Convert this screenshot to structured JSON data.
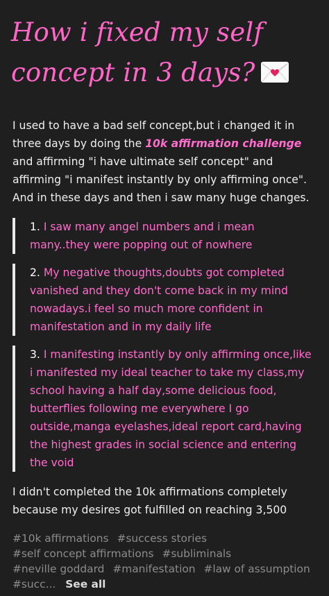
{
  "post": {
    "title_line1": "How i fixed my self",
    "title_line2": "concept in 3 days?",
    "title_emoji": "love-letter-icon",
    "intro_before": "I used to have a bad self concept,but i changed it in three days by doing the ",
    "intro_highlight": "10k affirmation challenge",
    "intro_after": " and affirming \"i have ultimate self concept\" and affirming \"i manifest instantly by only affirming once\". And in these days and then i saw many huge changes.",
    "quotes": [
      {
        "number": "1.",
        "text": "I saw many angel numbers and i mean many..they were popping out of nowhere"
      },
      {
        "number": "2.",
        "text": "My negative thoughts,doubts got completed vanished and they don't come back in my mind nowadays.i feel so much more confident in manifestation and in my daily life"
      },
      {
        "number": "3.",
        "text": "I manifesting instantly by only affirming once,like i manifested my ideal teacher to take my class,my school having a half day,some delicious food, butterflies following me everywhere I go outside,manga eyelashes,ideal report card,having the highest grades in social science and entering the void"
      }
    ],
    "outro": "I didn't completed the 10k affirmations completely because my desires got fulfilled on reaching 3,500"
  },
  "tags": {
    "items": [
      "#10k affirmations",
      "#success stories",
      "#self concept affirmations",
      "#subliminals",
      "#neville goddard",
      "#manifestation",
      "#law of assumption",
      "#succ..."
    ],
    "see_all": "See all"
  },
  "colors": {
    "background": "#1f1f1f",
    "accent_pink": "#ff6ccc",
    "title_pink": "#ff66c8",
    "text": "#f0f0f0",
    "tag_gray": "#8c8c8c",
    "quote_bar": "#e9e9e9"
  }
}
